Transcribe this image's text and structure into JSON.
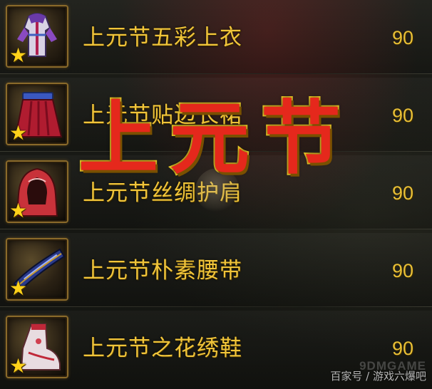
{
  "items": [
    {
      "name": "上元节五彩上衣",
      "level": "90",
      "icon": "robe-icon"
    },
    {
      "name": "上元节贴边长裙",
      "level": "90",
      "icon": "skirt-icon"
    },
    {
      "name": "上元节丝绸护肩",
      "level": "90",
      "icon": "hooded-shoulder-icon"
    },
    {
      "name": "上元节朴素腰带",
      "level": "90",
      "icon": "belt-icon"
    },
    {
      "name": "上元节之花绣鞋",
      "level": "90",
      "icon": "shoe-icon"
    }
  ],
  "star_glyph": "★",
  "overlay_title": "上元节",
  "watermark": {
    "caption": "百家号 / 游戏六爆吧",
    "logo": "9DMGAME"
  },
  "colors": {
    "item_text": "#f0c43a",
    "overlay_fill": "#e5281c",
    "overlay_stroke": "#f3d128",
    "slot_border": "#8a6a2a",
    "star": "#ffd21a"
  }
}
